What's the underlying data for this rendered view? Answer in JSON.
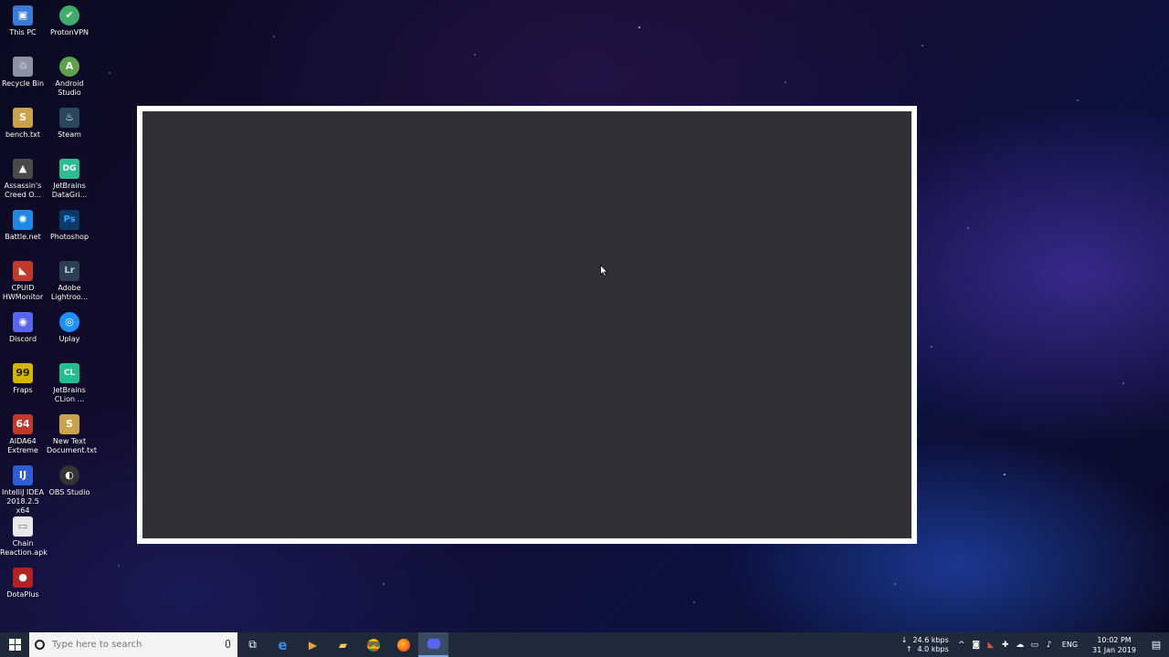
{
  "desktop": {
    "icons": [
      {
        "label": "This PC",
        "glyph": "▣",
        "color": "#3a7bd5"
      },
      {
        "label": "ProtonVPN",
        "glyph": "✔",
        "color": "#3fae6b"
      },
      {
        "label": "Recycle Bin",
        "glyph": "♲",
        "color": "#8a93a0"
      },
      {
        "label": "Android Studio",
        "glyph": "A",
        "color": "#5fa04e"
      },
      {
        "label": "bench.txt",
        "glyph": "S",
        "color": "#c9a24a"
      },
      {
        "label": "Steam",
        "glyph": "♨",
        "color": "#2a475e"
      },
      {
        "label": "Assassin's Creed O...",
        "glyph": "▲",
        "color": "#4a4a4a"
      },
      {
        "label": "JetBrains DataGri...",
        "glyph": "DG",
        "color": "#2bbf8f"
      },
      {
        "label": "Battle.net",
        "glyph": "✺",
        "color": "#1e88e5"
      },
      {
        "label": "Photoshop",
        "glyph": "Ps",
        "color": "#0b3a66"
      },
      {
        "label": "CPUID HWMonitor",
        "glyph": "◣",
        "color": "#c0392b"
      },
      {
        "label": "Adobe Lightroo...",
        "glyph": "Lr",
        "color": "#2c3e50"
      },
      {
        "label": "Discord",
        "glyph": "◉",
        "color": "#5865f2"
      },
      {
        "label": "Uplay",
        "glyph": "◎",
        "color": "#1e90ff"
      },
      {
        "label": "Fraps",
        "glyph": "99",
        "color": "#d4b600"
      },
      {
        "label": "JetBrains CLion ...",
        "glyph": "CL",
        "color": "#1fbf8f"
      },
      {
        "label": "AIDA64 Extreme",
        "glyph": "64",
        "color": "#c0392b"
      },
      {
        "label": "New Text Document.txt",
        "glyph": "S",
        "color": "#c9a24a"
      },
      {
        "label": "IntelliJ IDEA 2018.2.5 x64",
        "glyph": "IJ",
        "color": "#2c5fd6"
      },
      {
        "label": "OBS Studio",
        "glyph": "◐",
        "color": "#333333"
      },
      {
        "label": "Chain Reaction.apk",
        "glyph": "▭",
        "color": "#e8e8e8"
      },
      {
        "label": "DotaPlus",
        "glyph": "●",
        "color": "#b22222"
      }
    ]
  },
  "taskbar": {
    "search_placeholder": "Type here to search",
    "apps": [
      {
        "name": "task-view",
        "glyph": "⧉"
      },
      {
        "name": "edge",
        "glyph": "e"
      },
      {
        "name": "media",
        "glyph": "▶"
      },
      {
        "name": "file-explorer",
        "glyph": "▰"
      },
      {
        "name": "chrome",
        "glyph": "◉"
      },
      {
        "name": "firefox",
        "glyph": "◍"
      },
      {
        "name": "discord",
        "glyph": "◙"
      }
    ],
    "tray": {
      "download_speed": "24.6 kbps",
      "upload_speed": "4.0 kbps",
      "language": "ENG",
      "time": "10:02 PM",
      "date": "31 Jan 2019"
    }
  },
  "colors": {
    "taskbar_bg": "#1e2a3a",
    "window_frame": "#ffffff",
    "window_content": "#2f3136"
  }
}
